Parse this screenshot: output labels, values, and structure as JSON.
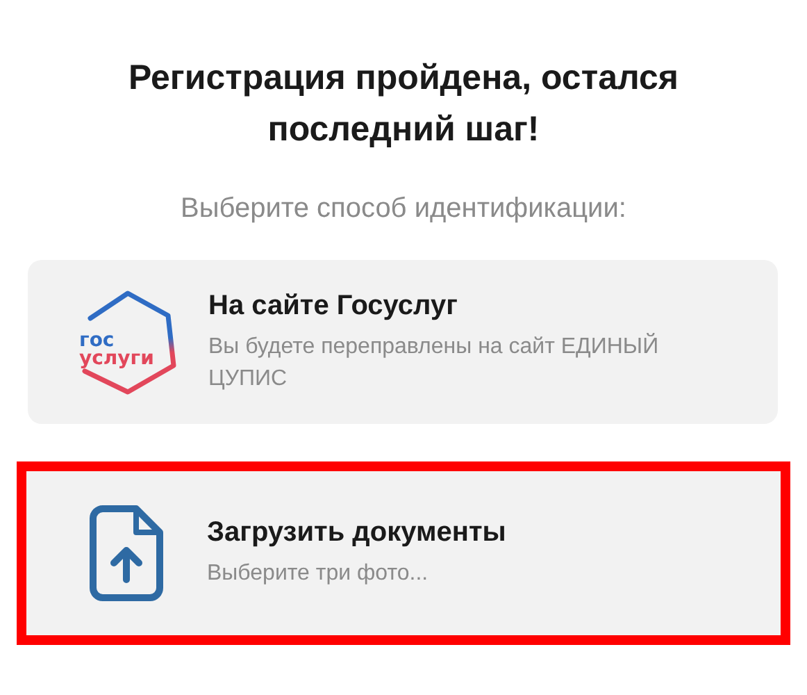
{
  "title": "Регистрация пройдена, остался последний шаг!",
  "subtitle": "Выберите способ идентификации:",
  "options": [
    {
      "kind": "gosuslugi",
      "logo_lines": [
        "гос",
        "услуги"
      ],
      "title": "На сайте Госуслуг",
      "description": "Вы будете переправлены на сайт ЕДИНЫЙ ЦУПИС",
      "highlighted": false
    },
    {
      "kind": "upload",
      "title": "Загрузить документы",
      "description": "Выберите три фото...",
      "highlighted": true
    }
  ]
}
